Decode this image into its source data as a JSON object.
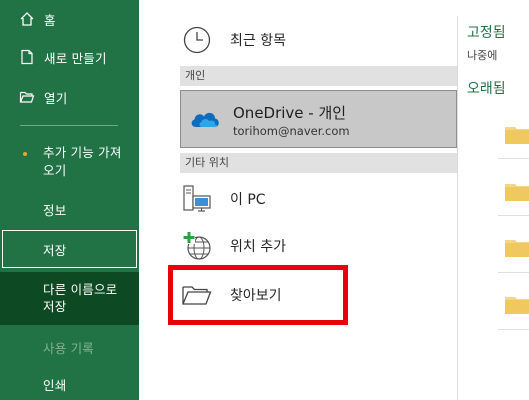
{
  "nav": {
    "home": "홈",
    "new": "새로 만들기",
    "open": "열기",
    "get_addins": "추가 기능 가져오기",
    "info": "정보",
    "save": "저장",
    "save_as": "다른 이름으로 저장",
    "history": "사용 기록",
    "print": "인쇄"
  },
  "locations": {
    "recent": "최근 항목",
    "personal_section": "개인",
    "onedrive_title": "OneDrive - 개인",
    "onedrive_account": "torihom@naver.com",
    "other_section": "기타 위치",
    "this_pc": "이 PC",
    "add_place": "위치 추가",
    "browse": "찾아보기"
  },
  "right_panel": {
    "pinned_title": "고정됨",
    "pinned_hint": "나중에",
    "older_title": "오래됨"
  },
  "colors": {
    "nav_bg": "#217346",
    "nav_selected_bg": "#0d4a24",
    "highlight": "#e8000c",
    "folder": "#f5d489"
  },
  "icons": [
    "home-icon",
    "new-document-icon",
    "folder-open-icon",
    "clock-icon",
    "onedrive-cloud-icon",
    "this-pc-icon",
    "add-place-globe-icon",
    "folder-browse-icon",
    "folder-icon"
  ]
}
